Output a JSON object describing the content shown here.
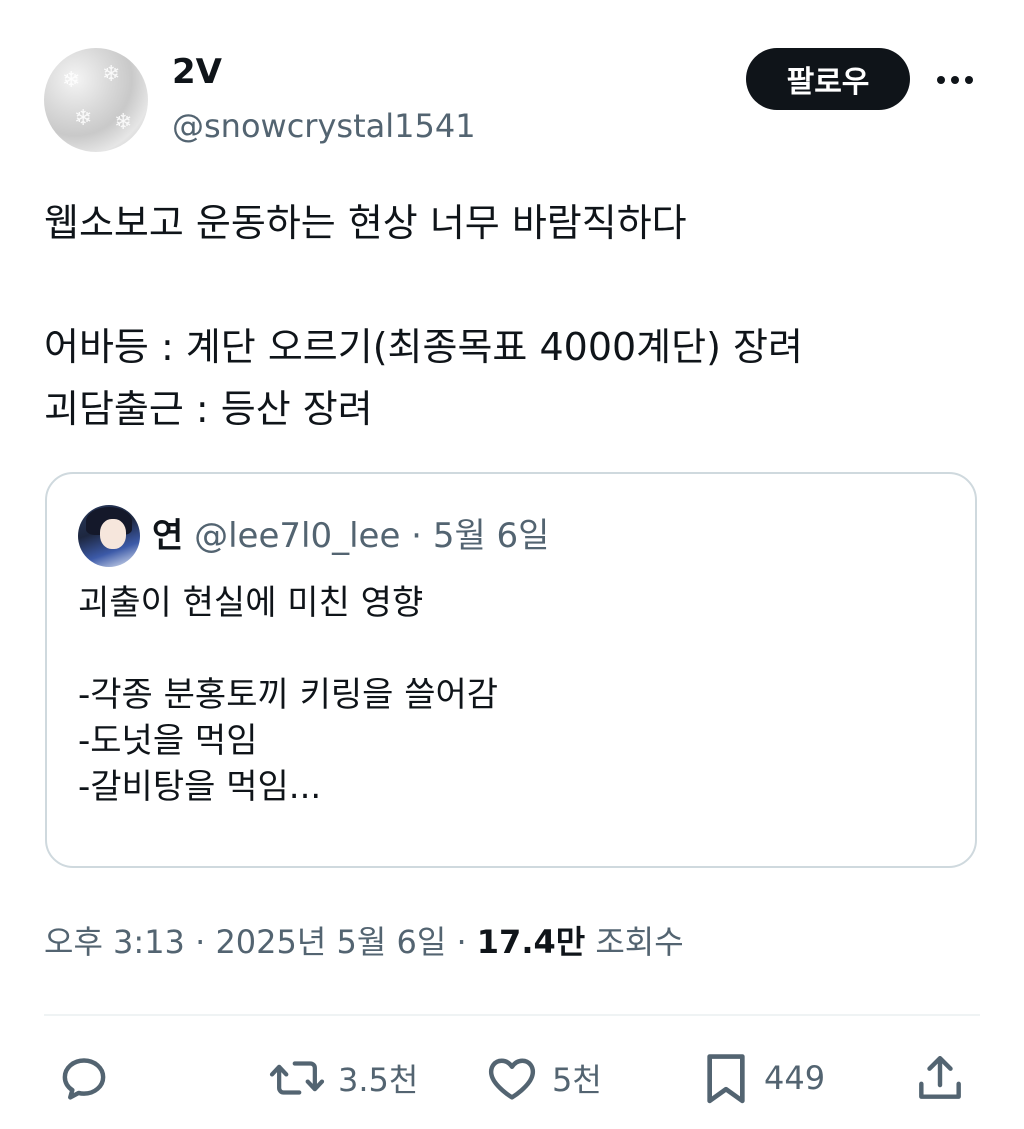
{
  "author": {
    "display_name": "2V",
    "handle": "@snowcrystal1541"
  },
  "follow_button": "팔로우",
  "post_text": "웹소보고 운동하는 현상 너무 바람직하다\n\n어바등 : 계단 오르기(최종목표 4000계단) 장려\n괴담출근 : 등산 장려",
  "quoted_post": {
    "author_name": "연",
    "handle": "@lee7l0_lee",
    "separator": " · ",
    "date": "5월 6일",
    "text": "괴출이 현실에 미친 영향\n\n-각종 분홍토끼 키링을 쓸어감\n-도넛을 먹임\n-갈비탕을 먹임..."
  },
  "meta": {
    "time": "오후 3:13",
    "separator": " · ",
    "date": "2025년 5월 6일",
    "views_count": "17.4만",
    "views_label": "조회수"
  },
  "actions": {
    "reply_count": "",
    "retweet_count": "3.5천",
    "like_count": "5천",
    "bookmark_count": "449"
  },
  "icons": [
    "reply-icon",
    "retweet-icon",
    "like-icon",
    "bookmark-icon",
    "share-icon",
    "more-icon"
  ],
  "colors": {
    "text": "#0f1419",
    "secondary": "#536471",
    "border": "#cfd9de",
    "button": "#0f1419"
  }
}
